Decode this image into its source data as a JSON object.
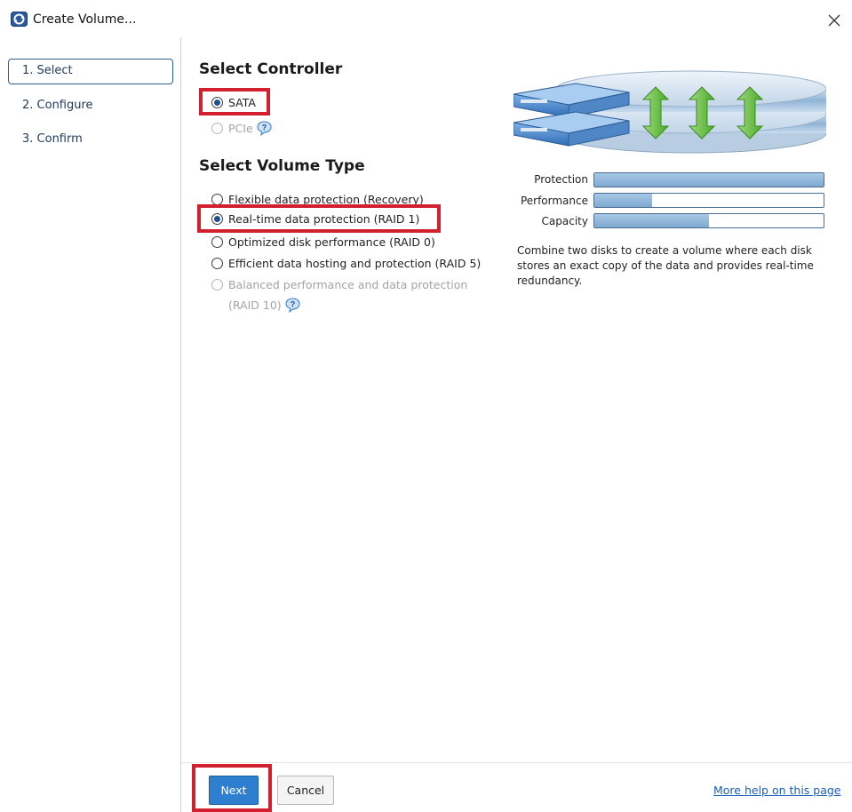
{
  "window": {
    "title": "Create Volume...",
    "close_symbol": "×",
    "icon": "raid-app-icon"
  },
  "sidebar": {
    "items": [
      {
        "label": "1. Select",
        "active": true
      },
      {
        "label": "2. Configure",
        "active": false
      },
      {
        "label": "3. Confirm",
        "active": false
      }
    ]
  },
  "controller": {
    "heading": "Select Controller",
    "options": [
      {
        "label": "SATA",
        "selected": true,
        "enabled": true
      },
      {
        "label": "PCIe",
        "selected": false,
        "enabled": false,
        "help_icon": "help-icon"
      }
    ]
  },
  "volume_type": {
    "heading": "Select Volume Type",
    "options": [
      {
        "label": "Flexible data protection (Recovery)",
        "selected": false,
        "enabled": true
      },
      {
        "label": "Real-time data protection (RAID 1)",
        "selected": true,
        "enabled": true
      },
      {
        "label": "Optimized disk performance (RAID 0)",
        "selected": false,
        "enabled": true
      },
      {
        "label": "Efficient data hosting and protection (RAID 5)",
        "selected": false,
        "enabled": true
      },
      {
        "label": "Balanced performance and data protection",
        "label_line2": "(RAID 10)",
        "selected": false,
        "enabled": false,
        "help_icon": "help-icon"
      }
    ]
  },
  "metrics": [
    {
      "label": "Protection",
      "fill_pct": 100
    },
    {
      "label": "Performance",
      "fill_pct": 25
    },
    {
      "label": "Capacity",
      "fill_pct": 50
    }
  ],
  "description": "Combine two disks to create a volume where each disk stores an exact copy of the data and provides real-time redundancy.",
  "illustration": "raid-1-mirror-illustration",
  "footer": {
    "next_label": "Next",
    "cancel_label": "Cancel",
    "help_link": "More help on this page"
  },
  "colors": {
    "highlight": "#d2202f",
    "accent": "#2f7fd0",
    "bar_fill": "#8fb5da",
    "link": "#1a5fb4"
  }
}
